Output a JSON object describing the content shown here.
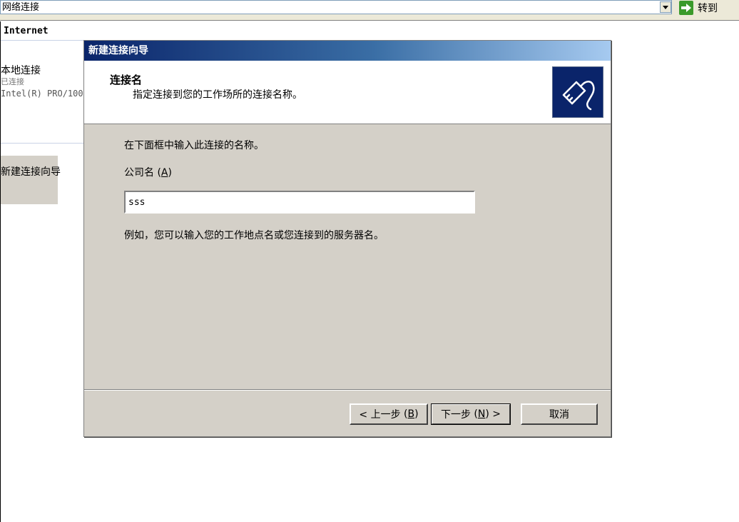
{
  "addressbar": {
    "address": "网络连接",
    "go_label": "转到"
  },
  "leftpane": {
    "heading": "Internet",
    "connection": {
      "name": "本地连接",
      "status": "已连接",
      "device": "Intel(R) PRO/100"
    },
    "wizard_label": "新建连接向导"
  },
  "dialog": {
    "title": "新建连接向导",
    "header_title": "连接名",
    "header_subtitle": "指定连接到您的工作场所的连接名称。",
    "intro": "在下面框中输入此连接的名称。",
    "field_label": "公司名",
    "field_accel": "A",
    "input_value": "sss",
    "example": "例如，您可以输入您的工作地点名或您连接到的服务器名。",
    "buttons": {
      "back": "< 上一步",
      "back_accel": "B",
      "next": "下一步",
      "next_accel": "N",
      "cancel": "取消"
    }
  },
  "colors": {
    "dialog_bg": "#d4d0c8",
    "title_start": "#0a246a",
    "title_end": "#a6caf0"
  }
}
